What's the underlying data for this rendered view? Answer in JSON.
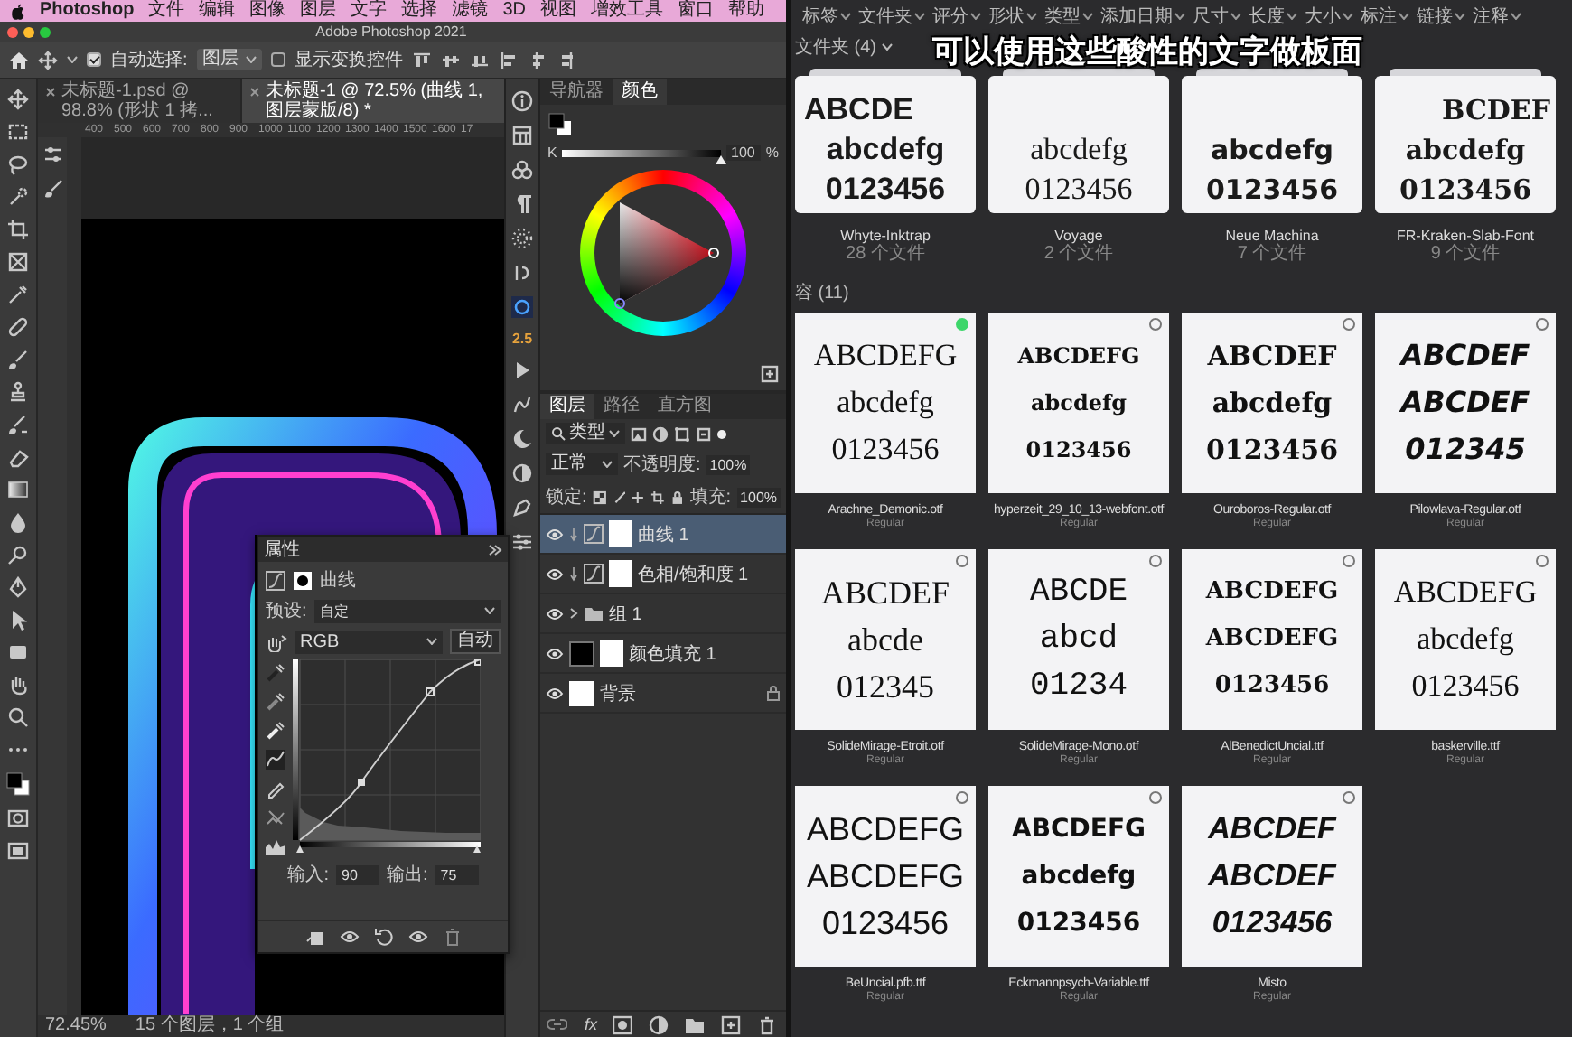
{
  "menu_bar": {
    "app": "Photoshop",
    "items": [
      "文件",
      "编辑",
      "图像",
      "图层",
      "文字",
      "选择",
      "滤镜",
      "3D",
      "视图",
      "增效工具",
      "窗口",
      "帮助"
    ]
  },
  "photoshop": {
    "title": "Adobe Photoshop 2021",
    "options_bar": {
      "auto_select": {
        "label": "自动选择:",
        "checked": true
      },
      "target": "图层",
      "show_transform": {
        "label": "显示变换控件",
        "checked": false
      }
    },
    "document_tabs": [
      {
        "label": "未标题-1.psd @ 98.8% (形状 1 拷...",
        "selected": false
      },
      {
        "label": "未标题-1 @ 72.5% (曲线 1, 图层蒙版/8) *",
        "selected": true
      }
    ],
    "ruler_marks": [
      "400",
      "500",
      "600",
      "700",
      "800",
      "900",
      "1000",
      "1100",
      "1200",
      "1300",
      "1400",
      "1500",
      "1600",
      "17"
    ],
    "brush_size": "2.5",
    "properties": {
      "title": "属性",
      "adjustment": "曲线",
      "preset_label": "预设:",
      "preset": "自定",
      "channel": "RGB",
      "auto": "自动",
      "input_label": "输入:",
      "input": "90",
      "output_label": "输出:",
      "output": "75"
    },
    "color_panel": {
      "tabs": [
        {
          "label": "导航器",
          "selected": false
        },
        {
          "label": "颜色",
          "selected": true
        }
      ],
      "slider": {
        "label": "K",
        "level": 1,
        "value": "100",
        "unit": "%"
      }
    },
    "layers_panel": {
      "tabs": [
        {
          "label": "图层",
          "selected": true
        },
        {
          "label": "路径",
          "selected": false
        },
        {
          "label": "直方图",
          "selected": false
        }
      ],
      "filter": "类型",
      "blend_mode": "正常",
      "opacity_label": "不透明度:",
      "opacity": "100%",
      "lock_label": "锁定:",
      "fill_label": "填充:",
      "fill": "100%",
      "layers": [
        {
          "name": "曲线 1",
          "kind": "adjustment",
          "selected": true,
          "visible": true
        },
        {
          "name": "色相/饱和度 1",
          "kind": "adjustment",
          "selected": false,
          "visible": true
        },
        {
          "name": "组 1",
          "kind": "group",
          "selected": false,
          "visible": true
        },
        {
          "name": "颜色填充 1",
          "kind": "fill",
          "selected": false,
          "visible": true
        },
        {
          "name": "背景",
          "kind": "background",
          "selected": false,
          "visible": true
        }
      ],
      "footer_fx": "fx"
    },
    "status_bar": {
      "zoom": "72.45%",
      "info": "15 个图层，1 个组"
    }
  },
  "library": {
    "filters": [
      "标签",
      "文件夹",
      "评分",
      "形状",
      "类型",
      "添加日期",
      "尺寸",
      "长度",
      "大小",
      "标注",
      "链接",
      "注释"
    ],
    "folders_heading": "文件夹 (4)",
    "folders": [
      {
        "name": "Whyte-Inktrap",
        "count": "28 个文件",
        "sample": [
          "ABCDE",
          "abcdefg",
          "0123456"
        ]
      },
      {
        "name": "Voyage",
        "count": "2 个文件",
        "sample": [
          "abcdefg",
          "0123456"
        ]
      },
      {
        "name": "Neue Machina",
        "count": "7 个文件",
        "sample": [
          "abcdefg",
          "0123456"
        ]
      },
      {
        "name": "FR-Kraken-Slab-Font",
        "count": "9 个文件",
        "sample": [
          "BCDEF",
          "abcdefg",
          "0123456"
        ]
      }
    ],
    "caption": "可以使用这些酸性的文字做板面",
    "files_heading": "容 (11)",
    "files": [
      {
        "name": "Arachne_Demonic.otf",
        "style": "Regular",
        "selected": true,
        "sample": [
          "ABCDEFG",
          "abcdefg",
          "0123456"
        ]
      },
      {
        "name": "hyperzeit_29_10_13-webfont.otf",
        "style": "Regular",
        "selected": false,
        "sample": [
          "ABCDEFG",
          "abcdefg",
          "0123456"
        ]
      },
      {
        "name": "Ouroboros-Regular.otf",
        "style": "Regular",
        "selected": false,
        "sample": [
          "ABCDEF",
          "abcdefg",
          "0123456"
        ]
      },
      {
        "name": "Pilowlava-Regular.otf",
        "style": "Regular",
        "selected": false,
        "sample": [
          "ABCDEF",
          "ABCDEF",
          "012345"
        ]
      },
      {
        "name": "SolideMirage-Etroit.otf",
        "style": "Regular",
        "selected": false,
        "sample": [
          "ABCDEF",
          "abcde",
          "012345"
        ]
      },
      {
        "name": "SolideMirage-Mono.otf",
        "style": "Regular",
        "selected": false,
        "sample": [
          "ABCDE",
          "abcd",
          "01234"
        ]
      },
      {
        "name": "AlBenedictUncial.ttf",
        "style": "Regular",
        "selected": false,
        "sample": [
          "ABCDEFG",
          "ABCDEFG",
          "0123456"
        ]
      },
      {
        "name": "baskerville.ttf",
        "style": "Regular",
        "selected": false,
        "sample": [
          "ABCDEFG",
          "abcdefg",
          "0123456"
        ]
      },
      {
        "name": "BeUncial.pfb.ttf",
        "style": "Regular",
        "selected": false,
        "sample": [
          "ABCDEFG",
          "ABCDEFG",
          "0123456"
        ]
      },
      {
        "name": "Eckmannpsych-Variable.ttf",
        "style": "Regular",
        "selected": false,
        "sample": [
          "ABCDEFG",
          "abcdefg",
          "0123456"
        ]
      },
      {
        "name": "Misto",
        "style": "Regular",
        "selected": false,
        "sample": [
          "ABCDEF",
          "ABCDEF",
          "0123456"
        ]
      }
    ]
  }
}
